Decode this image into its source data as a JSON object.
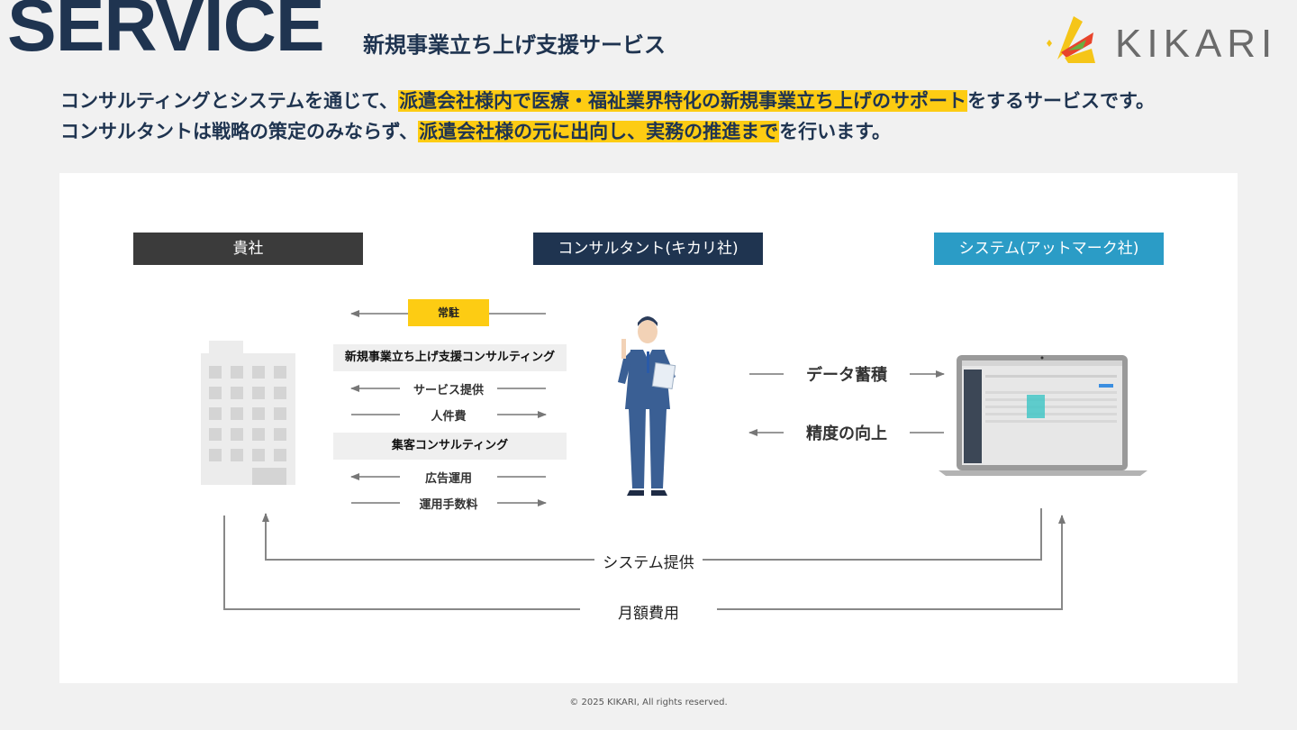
{
  "header": {
    "title": "SERVICE",
    "subtitle": "新規事業立ち上げ支援サービス",
    "logo_text": "KIKARI"
  },
  "intro": {
    "line1": {
      "before": "コンサルティングとシステムを通じて、",
      "highlight": "派遣会社様内で医療・福祉業界特化の新規事業立ち上げのサポート",
      "after": "をするサービスです。"
    },
    "line2": {
      "before": "コンサルタントは戦略の策定のみならず、",
      "highlight": "派遣会社様の元に出向し、実務の推進まで",
      "after": "を行います。"
    },
    "highlight_color": "#fdcc13"
  },
  "diagram": {
    "columns": {
      "client": "貴社",
      "consultant": "コンサルタント(キカリ社)",
      "system": "システム(アットマーク社)"
    },
    "column_colors": {
      "client": "#3b3b3b",
      "consultant": "#1f3450",
      "system": "#2b9cc6"
    },
    "stay": "常駐",
    "consulting_new_business": {
      "title": "新規事業立ち上げ支援コンサルティング",
      "service": "サービス提供",
      "cost": "人件費"
    },
    "consulting_marketing": {
      "title": "集客コンサルティング",
      "ads": "広告運用",
      "fee": "運用手数料"
    },
    "data_accumulation": "データ蓄積",
    "accuracy": "精度の向上",
    "system_provision": "システム提供",
    "monthly_fee": "月額費用"
  },
  "footer": {
    "copyright": "© 2025 KIKARI, All rights reserved."
  }
}
